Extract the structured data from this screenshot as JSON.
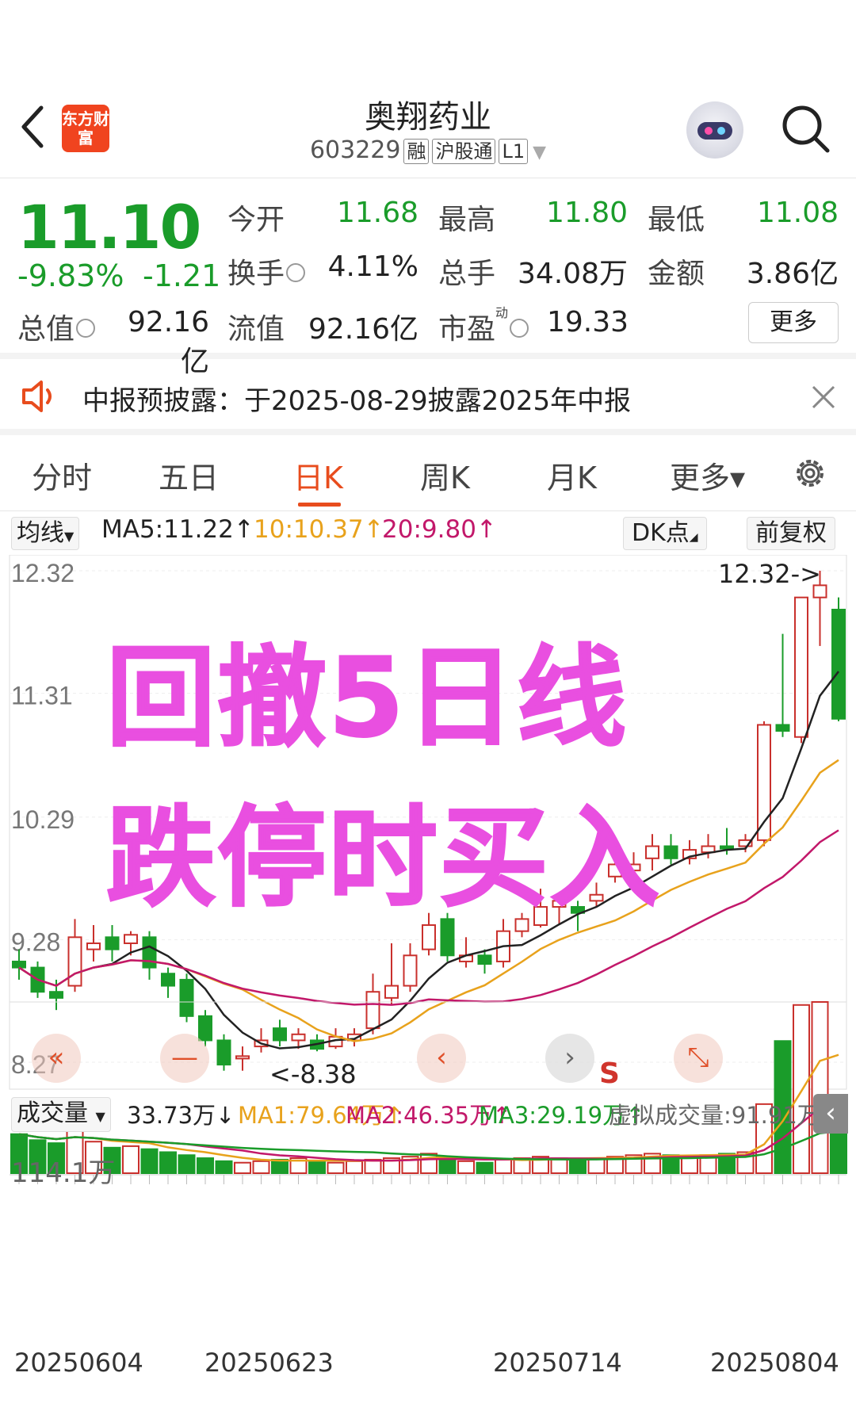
{
  "header": {
    "logo_text": "东方财富",
    "stock_name": "奥翔药业",
    "stock_code": "603229",
    "tags": [
      "融",
      "沪股通",
      "L1"
    ]
  },
  "quote": {
    "price": "11.10",
    "change_pct": "-9.83%",
    "change": "-1.21",
    "open_label": "今开",
    "open": "11.68",
    "high_label": "最高",
    "high": "11.80",
    "low_label": "最低",
    "low": "11.08",
    "turnover_label": "换手",
    "turnover": "4.11%",
    "volume_label": "总手",
    "volume": "34.08万",
    "amount_label": "金额",
    "amount": "3.86亿",
    "mktcap_label": "总值",
    "mktcap": "92.16亿",
    "float_label": "流值",
    "float_cap": "92.16亿",
    "pe_label": "市盈",
    "pe_sup": "动",
    "pe": "19.33",
    "more": "更多",
    "colors": {
      "down": "#1a9c2a",
      "up": "#c9302c"
    }
  },
  "notice": {
    "text": "中报预披露：于2025-08-29披露2025年中报"
  },
  "tabs": [
    "分时",
    "五日",
    "日K",
    "周K",
    "月K",
    "更多▾"
  ],
  "active_tab": "日K",
  "ma_bar": {
    "selector": "均线",
    "ma5": "MA5:11.22↑",
    "ma10": "10:10.37↑",
    "ma20": "20:9.80↑",
    "dk": "DK点",
    "adjust": "前复权"
  },
  "price_axis": [
    "12.32",
    "11.31",
    "10.29",
    "9.28",
    "8.27"
  ],
  "annotations": {
    "high": "12.32->",
    "low": "<-8.38",
    "signal": "S"
  },
  "overlay": {
    "line1": "回撤5日线",
    "line2": "跌停时买入"
  },
  "vol_bar": {
    "selector": "成交量",
    "vol": "33.73万↓",
    "ma1": "MA1:79.64万↑",
    "ma2": "MA2:46.35万↑",
    "ma3": "MA3:29.19万↑",
    "virtual": "虚拟成交量:91.91万"
  },
  "vol_axis_max": "114.1万",
  "dates": [
    "20250604",
    "20250623",
    "20250714",
    "20250804"
  ],
  "chart_data": {
    "type": "candlestick",
    "ylim": [
      8.27,
      12.32
    ],
    "candles": [
      [
        9.1,
        9.05,
        9.2,
        8.95
      ],
      [
        9.05,
        8.85,
        9.1,
        8.8
      ],
      [
        8.85,
        8.8,
        8.95,
        8.7
      ],
      [
        8.9,
        9.3,
        9.45,
        8.85
      ],
      [
        9.2,
        9.25,
        9.4,
        9.1
      ],
      [
        9.3,
        9.2,
        9.4,
        9.1
      ],
      [
        9.25,
        9.32,
        9.35,
        9.15
      ],
      [
        9.3,
        9.05,
        9.35,
        8.95
      ],
      [
        9.0,
        8.9,
        9.05,
        8.8
      ],
      [
        8.95,
        8.65,
        9.0,
        8.6
      ],
      [
        8.65,
        8.45,
        8.7,
        8.4
      ],
      [
        8.45,
        8.25,
        8.5,
        8.2
      ],
      [
        8.3,
        8.32,
        8.4,
        8.2
      ],
      [
        8.4,
        8.45,
        8.55,
        8.35
      ],
      [
        8.55,
        8.45,
        8.62,
        8.4
      ],
      [
        8.45,
        8.5,
        8.55,
        8.38
      ],
      [
        8.45,
        8.38,
        8.5,
        8.36
      ],
      [
        8.4,
        8.48,
        8.55,
        8.38
      ],
      [
        8.45,
        8.5,
        8.55,
        8.4
      ],
      [
        8.55,
        8.85,
        9.0,
        8.5
      ],
      [
        8.8,
        8.9,
        9.25,
        8.75
      ],
      [
        8.9,
        9.15,
        9.25,
        8.85
      ],
      [
        9.2,
        9.4,
        9.5,
        9.15
      ],
      [
        9.45,
        9.15,
        9.5,
        9.1
      ],
      [
        9.1,
        9.15,
        9.3,
        9.05
      ],
      [
        9.15,
        9.08,
        9.2,
        9.0
      ],
      [
        9.1,
        9.35,
        9.45,
        9.05
      ],
      [
        9.35,
        9.45,
        9.5,
        9.3
      ],
      [
        9.4,
        9.55,
        9.7,
        9.38
      ],
      [
        9.55,
        9.6,
        9.65,
        9.4
      ],
      [
        9.55,
        9.5,
        9.6,
        9.35
      ],
      [
        9.6,
        9.65,
        9.75,
        9.55
      ],
      [
        9.8,
        9.9,
        10.0,
        9.75
      ],
      [
        9.85,
        9.9,
        10.0,
        9.75
      ],
      [
        9.95,
        10.05,
        10.15,
        9.85
      ],
      [
        10.05,
        9.95,
        10.15,
        9.9
      ],
      [
        9.95,
        10.02,
        10.1,
        9.9
      ],
      [
        10.0,
        10.05,
        10.15,
        9.95
      ],
      [
        10.05,
        10.03,
        10.2,
        9.98
      ],
      [
        10.05,
        10.1,
        10.15,
        10.0
      ],
      [
        10.1,
        11.05,
        11.08,
        10.05
      ],
      [
        11.05,
        11.0,
        11.8,
        10.95
      ],
      [
        10.95,
        12.1,
        12.1,
        10.9
      ],
      [
        12.1,
        12.2,
        12.32,
        11.7
      ],
      [
        12.0,
        11.1,
        12.1,
        11.08
      ]
    ],
    "volume_max_label": "114.1万",
    "volume": [
      26,
      22,
      20,
      28,
      21,
      17,
      18,
      16,
      14,
      12,
      10,
      8,
      7,
      8,
      9,
      10,
      8,
      7,
      8,
      9,
      10,
      11,
      13,
      10,
      8,
      7,
      9,
      10,
      11,
      10,
      9,
      10,
      11,
      12,
      13,
      12,
      11,
      12,
      13,
      14,
      46,
      88,
      112,
      114,
      34
    ],
    "series": [
      {
        "name": "MA5",
        "value": "11.22"
      },
      {
        "name": "MA10",
        "value": "10.37"
      },
      {
        "name": "MA20",
        "value": "9.80"
      }
    ]
  }
}
